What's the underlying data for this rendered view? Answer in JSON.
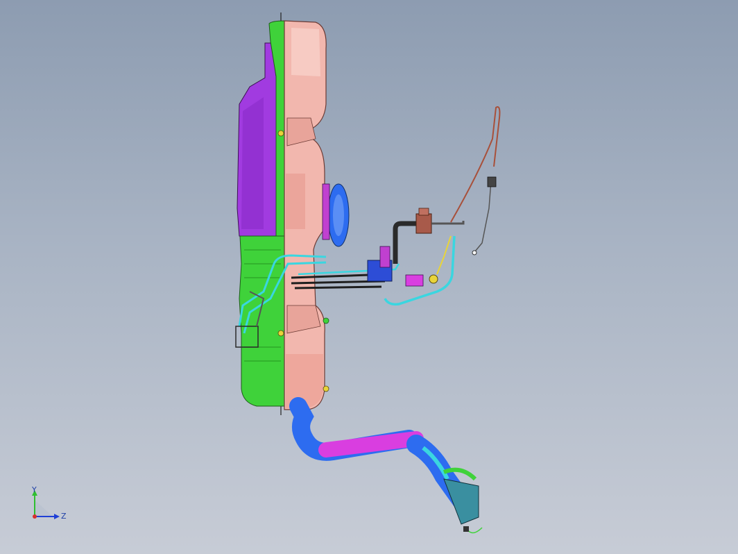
{
  "viewport": {
    "background_top": "#8d9cb1",
    "background_bottom": "#c7ccd6"
  },
  "model": {
    "colors": {
      "tank_shell": "#f2b7ae",
      "tank_shell_dark": "#e39387",
      "tank_side_green": "#3fd23a",
      "tank_side_purple": "#a13be0",
      "filler_pipe_magenta": "#d93ee0",
      "filler_pipe_blue": "#2d6cf0",
      "hose_cyan": "#3ad6e0",
      "bracket_black": "#2a2a2a",
      "vent_line_red": "#a8503a",
      "valve_brown": "#a85a4a",
      "bolt_yellow": "#e8d43a"
    }
  },
  "triad": {
    "y_label": "Y",
    "z_label": "Z",
    "y_color": "#2fbf2f",
    "z_color": "#1f3fd6",
    "x_color": "#d62f2f"
  }
}
